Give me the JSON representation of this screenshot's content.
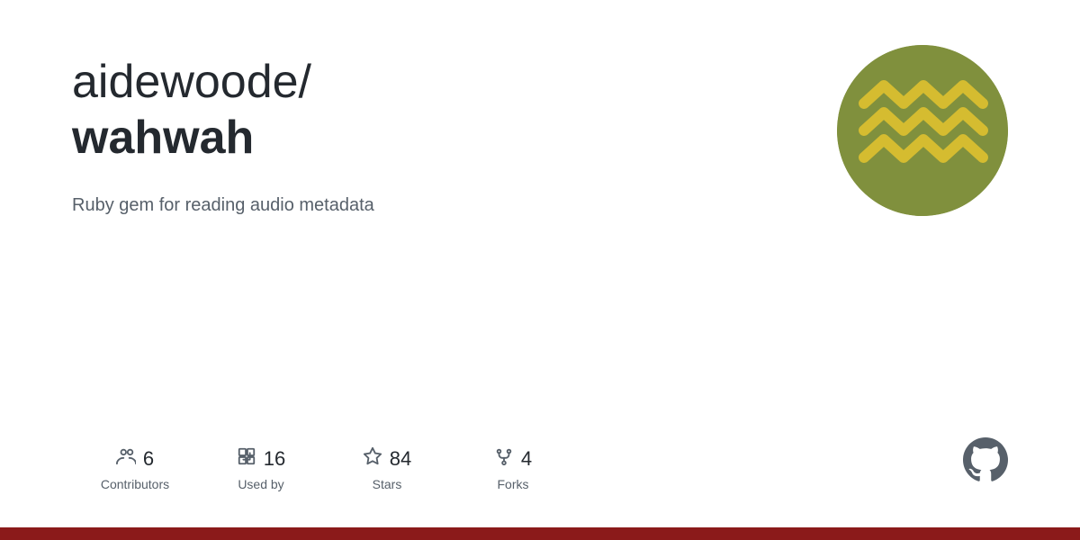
{
  "repo": {
    "owner": "aidewoode/",
    "name": "wahwah",
    "description": "Ruby gem for reading audio metadata"
  },
  "stats": [
    {
      "icon": "contributors-icon",
      "number": "6",
      "label": "Contributors"
    },
    {
      "icon": "used-by-icon",
      "number": "16",
      "label": "Used by"
    },
    {
      "icon": "stars-icon",
      "number": "84",
      "label": "Stars"
    },
    {
      "icon": "forks-icon",
      "number": "4",
      "label": "Forks"
    }
  ],
  "bottom_bar_color": "#8b1a1a"
}
